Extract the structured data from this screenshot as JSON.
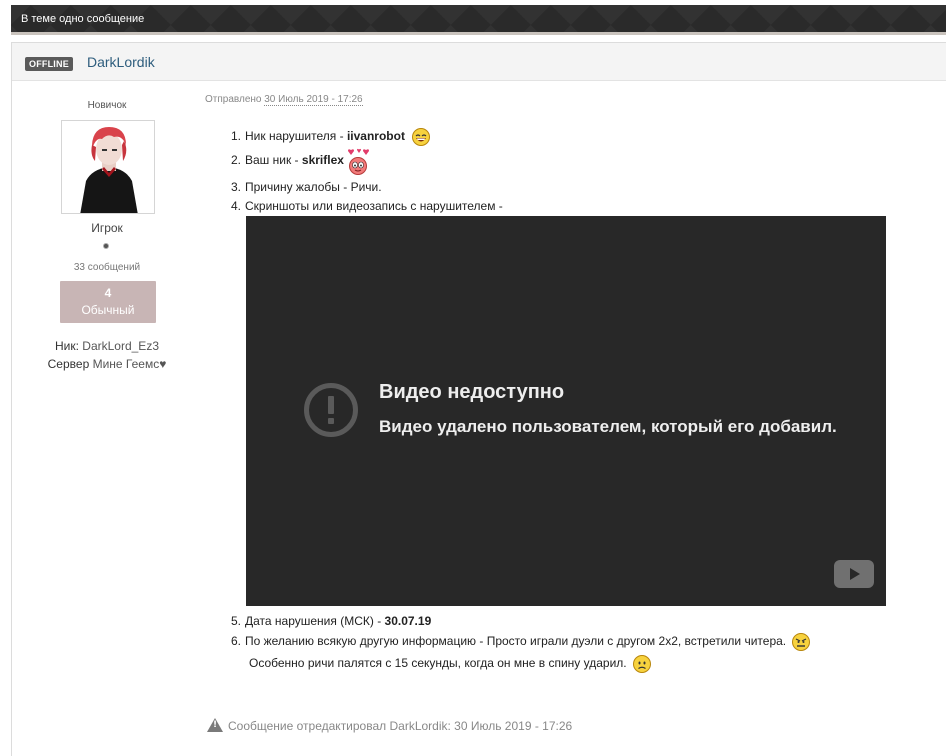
{
  "topbar": {
    "title": "В теме одно сообщение"
  },
  "post": {
    "status_badge": "OFFLINE",
    "author": "DarkLordik",
    "author_info": {
      "rank_title": "Новичок",
      "group": "Игрок",
      "post_count": "33 сообщений",
      "reputation_value": "4",
      "reputation_label": "Обычный",
      "nick_label": "Ник:",
      "nick_value": "DarkLord_Ez3",
      "server_label": "Сервер",
      "server_value": "Мине Геемс♥"
    },
    "date_prefix": "Отправлено",
    "date": "30 Июль 2019 - 17:26",
    "items": [
      {
        "num": "1.",
        "text": "Ник нарушителя - ",
        "bold": "iivanrobot",
        "smiley": "laughing-smiley-icon"
      },
      {
        "num": "2.",
        "text": "Ваш ник - ",
        "bold": "skriflex",
        "smiley": "in-love-smiley-icon"
      },
      {
        "num": "3.",
        "text": "Причину жалобы - Ричи."
      },
      {
        "num": "4.",
        "text": "Скриншоты или видеозапись с нарушителем -"
      },
      {
        "num": "5.",
        "text": "Дата нарушения (МСК) - ",
        "bold": "30.07.19"
      },
      {
        "num": "6.",
        "text": "По желанию всякую другую информацию - Просто играли дуэли с другом 2х2, встретили читера.",
        "smiley": "angry-smiley-icon"
      }
    ],
    "item6_continuation": "Особенно ричи палятся с 15 секунды, когда он мне в спину ударил.",
    "video": {
      "title": "Видео недоступно",
      "subtitle": "Видео удалено пользователем, который его добавил."
    },
    "edit_note": "Сообщение отредактировал DarkLordik: 30 Июль 2019 - 17:26"
  },
  "colors": {
    "topbar_bg": "#2a2a2a",
    "author_link": "#2e5d7d",
    "reputation_bg": "#c8b5b5",
    "video_bg": "#282828"
  }
}
